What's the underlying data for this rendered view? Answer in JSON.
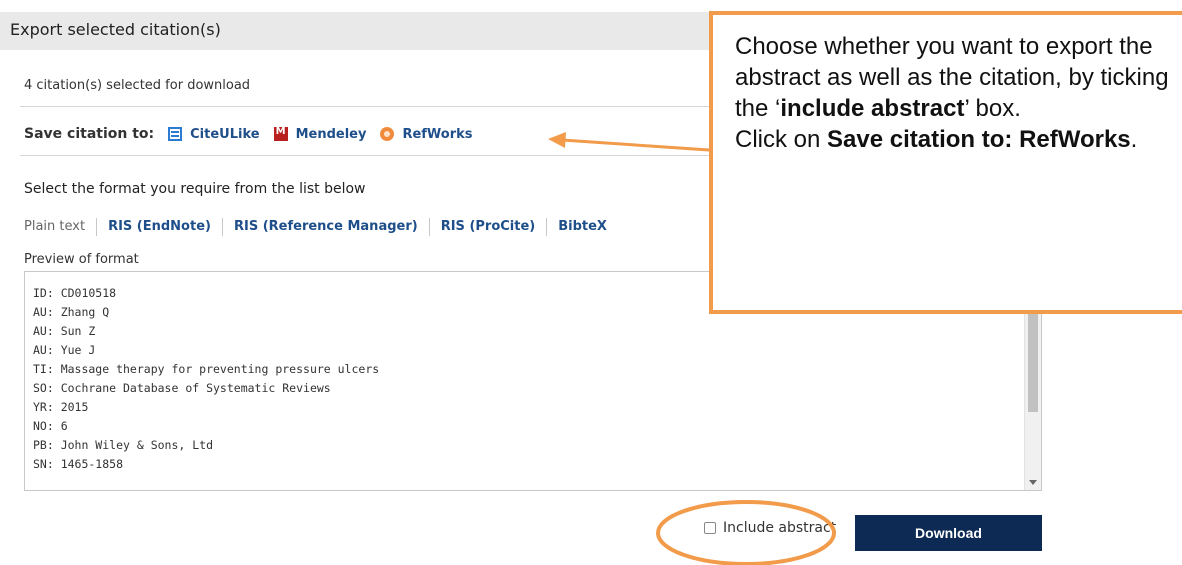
{
  "header": {
    "title": "Export selected citation(s)"
  },
  "selection": {
    "count_text": "4 citation(s) selected for download"
  },
  "save_to": {
    "label": "Save citation to:",
    "providers": [
      {
        "name": "CiteULike",
        "icon": "citeulike-icon",
        "color": "#2a7bd1"
      },
      {
        "name": "Mendeley",
        "icon": "mendeley-icon",
        "color": "#b8201e"
      },
      {
        "name": "RefWorks",
        "icon": "refworks-icon",
        "color": "#f08a3c"
      }
    ]
  },
  "formats": {
    "heading": "Select the format you require from the list below",
    "options": [
      "Plain text",
      "RIS (EndNote)",
      "RIS (Reference Manager)",
      "RIS (ProCite)",
      "BibteX"
    ],
    "selected": "Plain text"
  },
  "preview": {
    "label": "Preview of format",
    "lines": [
      "ID: CD010518",
      "AU: Zhang Q",
      "AU: Sun Z",
      "AU: Yue J",
      "TI: Massage therapy for preventing pressure ulcers",
      "SO: Cochrane Database of Systematic Reviews",
      "YR: 2015",
      "NO: 6",
      "PB: John Wiley & Sons, Ltd",
      "SN: 1465-1858"
    ]
  },
  "actions": {
    "include_abstract_label": "Include abstract",
    "include_abstract_checked": false,
    "download_label": "Download"
  },
  "callout": {
    "line1": "Choose whether you want to export the abstract as well as the citation, by ticking the ‘",
    "bold1": "include abstract",
    "line2": "’ box.",
    "line3": "Click on ",
    "bold2": "Save citation to: RefWorks",
    "line4": "."
  },
  "colors": {
    "accent_orange": "#f29b4a",
    "link_blue": "#1f4f8a",
    "button_navy": "#0d2a54",
    "header_gray": "#e9e9e9"
  }
}
